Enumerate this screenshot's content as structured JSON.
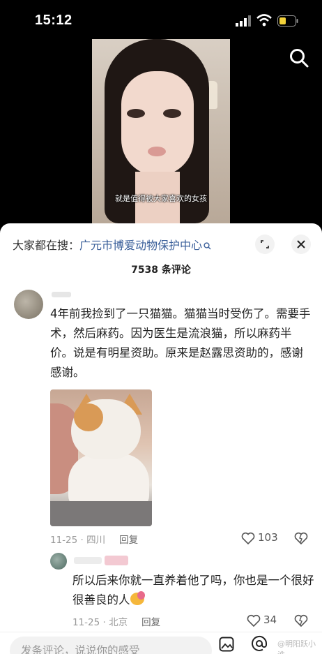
{
  "status_bar": {
    "time": "15:12"
  },
  "video": {
    "caption": "就是值得被大家喜欢的女孩"
  },
  "sheet": {
    "hot_search_prefix": "大家都在搜：",
    "hot_search_link": "广元市博爱动物保护中心",
    "comment_count": "7538 条评论"
  },
  "comment1": {
    "text": "4年前我捡到了一只猫猫。猫猫当时受伤了。需要手术，然后麻药。因为医生是流浪猫，所以麻药半价。说是有明星资助。原来是赵露思资助的，感谢感谢。",
    "date": "11-25 · 四川",
    "reply_label": "回复",
    "likes": "103"
  },
  "reply1": {
    "text": "所以后来你就一直养着他了吗，你也是一个很好很善良的人",
    "date": "11-25 · 北京",
    "reply_label": "回复",
    "likes": "34"
  },
  "input_bar": {
    "placeholder": "发条评论，说说你的感受",
    "watermark": "@明阳跃小淮"
  }
}
